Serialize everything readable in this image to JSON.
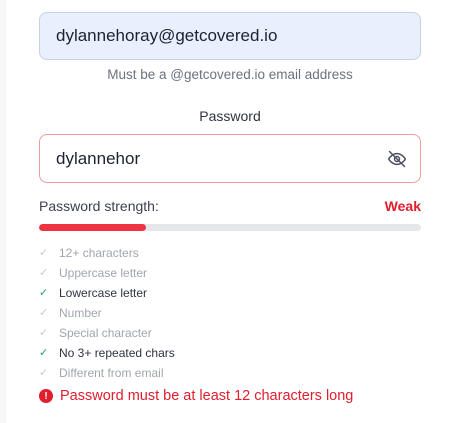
{
  "email": {
    "value": "dylannehoray@getcovered.io",
    "hint": "Must be a @getcovered.io email address"
  },
  "password": {
    "label": "Password",
    "value": "dylannehor",
    "toggle_icon": "eye-off-icon"
  },
  "strength": {
    "label": "Password strength:",
    "value": "Weak",
    "fill_fraction": 0.28,
    "fill_color": "#ef3340"
  },
  "requirements": [
    {
      "text": "12+ characters",
      "met": false
    },
    {
      "text": "Uppercase letter",
      "met": false
    },
    {
      "text": "Lowercase letter",
      "met": true
    },
    {
      "text": "Number",
      "met": false
    },
    {
      "text": "Special character",
      "met": false
    },
    {
      "text": "No 3+ repeated chars",
      "met": true
    },
    {
      "text": "Different from email",
      "met": false
    }
  ],
  "error": {
    "icon": "alert-circle-icon",
    "message": "Password must be at least 12 characters long"
  },
  "colors": {
    "error": "#e11d2e",
    "success": "#22a55a",
    "email_bg": "#e8f0fe"
  }
}
